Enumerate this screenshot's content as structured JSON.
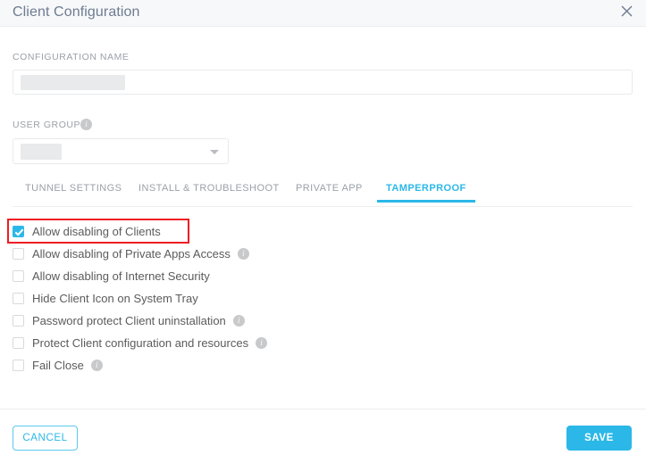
{
  "dialog": {
    "title": "Client Configuration",
    "close_icon": "close-icon"
  },
  "form": {
    "configuration_name": {
      "label": "CONFIGURATION NAME",
      "value": "",
      "redacted": true
    },
    "user_group": {
      "label": "USER GROUP",
      "value": "",
      "redacted": true,
      "info_icon": "info-icon"
    }
  },
  "tabs": [
    {
      "label": "TUNNEL SETTINGS",
      "active": false
    },
    {
      "label": "INSTALL & TROUBLESHOOT",
      "active": false
    },
    {
      "label": "PRIVATE APP",
      "active": false
    },
    {
      "label": "TAMPERPROOF",
      "active": true
    }
  ],
  "checkboxes": [
    {
      "label": "Allow disabling of Clients",
      "checked": true,
      "has_info": false,
      "highlighted": true
    },
    {
      "label": "Allow disabling of Private Apps Access",
      "checked": false,
      "has_info": true,
      "highlighted": false
    },
    {
      "label": "Allow disabling of Internet Security",
      "checked": false,
      "has_info": false,
      "highlighted": false
    },
    {
      "label": "Hide Client Icon on System Tray",
      "checked": false,
      "has_info": false,
      "highlighted": false
    },
    {
      "label": "Password protect Client uninstallation",
      "checked": false,
      "has_info": true,
      "highlighted": false
    },
    {
      "label": "Protect Client configuration and resources",
      "checked": false,
      "has_info": true,
      "highlighted": false
    },
    {
      "label": "Fail Close",
      "checked": false,
      "has_info": true,
      "highlighted": false
    }
  ],
  "footer": {
    "cancel_label": "CANCEL",
    "save_label": "SAVE"
  },
  "colors": {
    "accent": "#2bb8e8",
    "annotation": "#ee1c25",
    "header_bg": "#f7f8f9",
    "title_text": "#6e7b92",
    "label_text": "#9aa1aa"
  }
}
